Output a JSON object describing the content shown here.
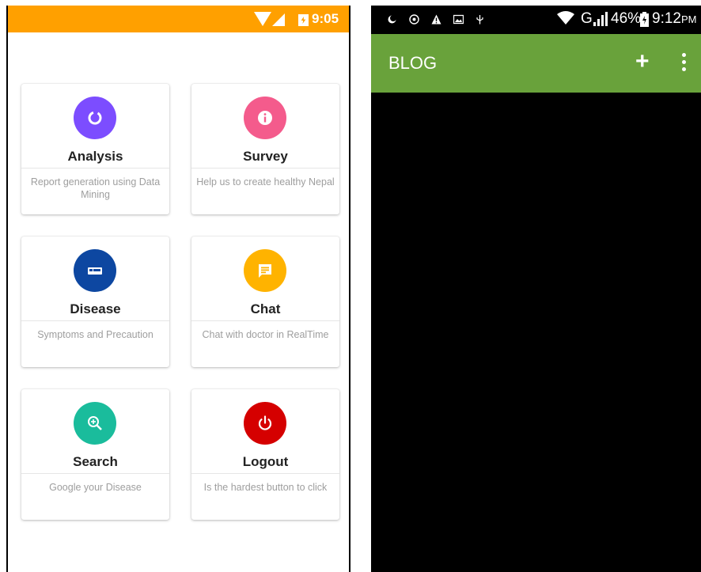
{
  "left_phone": {
    "status_bar": {
      "time": "9:05",
      "color": "#ffa000"
    },
    "cards": [
      {
        "title": "Analysis",
        "desc": "Report generation using Data Mining",
        "icon": "donut-chart-icon",
        "color": "#7c4dff"
      },
      {
        "title": "Survey",
        "desc": "Help us to create healthy Nepal",
        "icon": "info-icon",
        "color": "#f45b8c"
      },
      {
        "title": "Disease",
        "desc": "Symptoms and Precaution",
        "icon": "hospital-bed-icon",
        "color": "#0d47a1"
      },
      {
        "title": "Chat",
        "desc": "Chat with doctor in RealTime",
        "icon": "chat-icon",
        "color": "#ffb300"
      },
      {
        "title": "Search",
        "desc": "Google your Disease",
        "icon": "search-icon",
        "color": "#1abc9c"
      },
      {
        "title": "Logout",
        "desc": "Is the hardest button to click",
        "icon": "power-icon",
        "color": "#d50000"
      }
    ]
  },
  "right_phone": {
    "status_bar": {
      "network": "G",
      "battery": "46%",
      "time": "9:12",
      "time_suffix": "PM"
    },
    "app_bar": {
      "title": "BLOG",
      "color": "#69a23b",
      "add_icon": "+"
    }
  }
}
